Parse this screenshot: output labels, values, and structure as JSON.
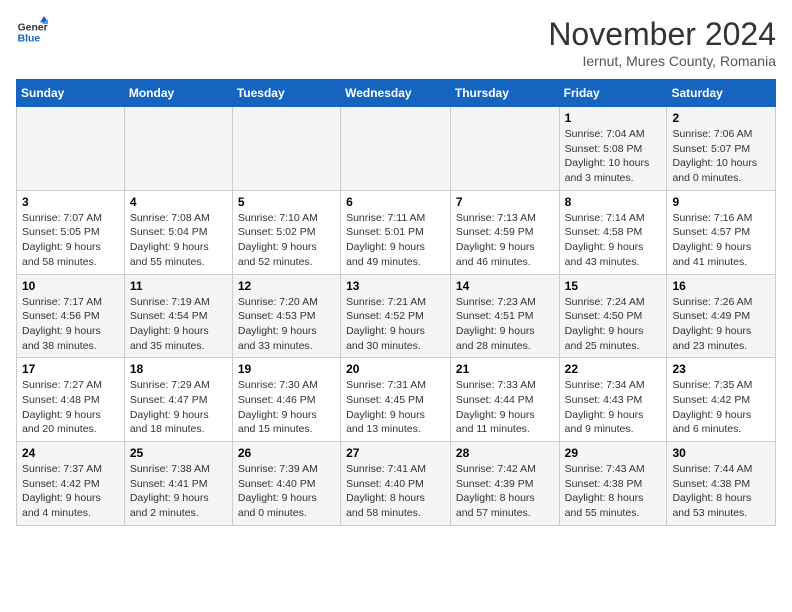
{
  "header": {
    "logo_line1": "General",
    "logo_line2": "Blue",
    "month_title": "November 2024",
    "location": "Iernut, Mures County, Romania"
  },
  "days_of_week": [
    "Sunday",
    "Monday",
    "Tuesday",
    "Wednesday",
    "Thursday",
    "Friday",
    "Saturday"
  ],
  "weeks": [
    [
      {
        "day": "",
        "info": ""
      },
      {
        "day": "",
        "info": ""
      },
      {
        "day": "",
        "info": ""
      },
      {
        "day": "",
        "info": ""
      },
      {
        "day": "",
        "info": ""
      },
      {
        "day": "1",
        "info": "Sunrise: 7:04 AM\nSunset: 5:08 PM\nDaylight: 10 hours\nand 3 minutes."
      },
      {
        "day": "2",
        "info": "Sunrise: 7:06 AM\nSunset: 5:07 PM\nDaylight: 10 hours\nand 0 minutes."
      }
    ],
    [
      {
        "day": "3",
        "info": "Sunrise: 7:07 AM\nSunset: 5:05 PM\nDaylight: 9 hours\nand 58 minutes."
      },
      {
        "day": "4",
        "info": "Sunrise: 7:08 AM\nSunset: 5:04 PM\nDaylight: 9 hours\nand 55 minutes."
      },
      {
        "day": "5",
        "info": "Sunrise: 7:10 AM\nSunset: 5:02 PM\nDaylight: 9 hours\nand 52 minutes."
      },
      {
        "day": "6",
        "info": "Sunrise: 7:11 AM\nSunset: 5:01 PM\nDaylight: 9 hours\nand 49 minutes."
      },
      {
        "day": "7",
        "info": "Sunrise: 7:13 AM\nSunset: 4:59 PM\nDaylight: 9 hours\nand 46 minutes."
      },
      {
        "day": "8",
        "info": "Sunrise: 7:14 AM\nSunset: 4:58 PM\nDaylight: 9 hours\nand 43 minutes."
      },
      {
        "day": "9",
        "info": "Sunrise: 7:16 AM\nSunset: 4:57 PM\nDaylight: 9 hours\nand 41 minutes."
      }
    ],
    [
      {
        "day": "10",
        "info": "Sunrise: 7:17 AM\nSunset: 4:56 PM\nDaylight: 9 hours\nand 38 minutes."
      },
      {
        "day": "11",
        "info": "Sunrise: 7:19 AM\nSunset: 4:54 PM\nDaylight: 9 hours\nand 35 minutes."
      },
      {
        "day": "12",
        "info": "Sunrise: 7:20 AM\nSunset: 4:53 PM\nDaylight: 9 hours\nand 33 minutes."
      },
      {
        "day": "13",
        "info": "Sunrise: 7:21 AM\nSunset: 4:52 PM\nDaylight: 9 hours\nand 30 minutes."
      },
      {
        "day": "14",
        "info": "Sunrise: 7:23 AM\nSunset: 4:51 PM\nDaylight: 9 hours\nand 28 minutes."
      },
      {
        "day": "15",
        "info": "Sunrise: 7:24 AM\nSunset: 4:50 PM\nDaylight: 9 hours\nand 25 minutes."
      },
      {
        "day": "16",
        "info": "Sunrise: 7:26 AM\nSunset: 4:49 PM\nDaylight: 9 hours\nand 23 minutes."
      }
    ],
    [
      {
        "day": "17",
        "info": "Sunrise: 7:27 AM\nSunset: 4:48 PM\nDaylight: 9 hours\nand 20 minutes."
      },
      {
        "day": "18",
        "info": "Sunrise: 7:29 AM\nSunset: 4:47 PM\nDaylight: 9 hours\nand 18 minutes."
      },
      {
        "day": "19",
        "info": "Sunrise: 7:30 AM\nSunset: 4:46 PM\nDaylight: 9 hours\nand 15 minutes."
      },
      {
        "day": "20",
        "info": "Sunrise: 7:31 AM\nSunset: 4:45 PM\nDaylight: 9 hours\nand 13 minutes."
      },
      {
        "day": "21",
        "info": "Sunrise: 7:33 AM\nSunset: 4:44 PM\nDaylight: 9 hours\nand 11 minutes."
      },
      {
        "day": "22",
        "info": "Sunrise: 7:34 AM\nSunset: 4:43 PM\nDaylight: 9 hours\nand 9 minutes."
      },
      {
        "day": "23",
        "info": "Sunrise: 7:35 AM\nSunset: 4:42 PM\nDaylight: 9 hours\nand 6 minutes."
      }
    ],
    [
      {
        "day": "24",
        "info": "Sunrise: 7:37 AM\nSunset: 4:42 PM\nDaylight: 9 hours\nand 4 minutes."
      },
      {
        "day": "25",
        "info": "Sunrise: 7:38 AM\nSunset: 4:41 PM\nDaylight: 9 hours\nand 2 minutes."
      },
      {
        "day": "26",
        "info": "Sunrise: 7:39 AM\nSunset: 4:40 PM\nDaylight: 9 hours\nand 0 minutes."
      },
      {
        "day": "27",
        "info": "Sunrise: 7:41 AM\nSunset: 4:40 PM\nDaylight: 8 hours\nand 58 minutes."
      },
      {
        "day": "28",
        "info": "Sunrise: 7:42 AM\nSunset: 4:39 PM\nDaylight: 8 hours\nand 57 minutes."
      },
      {
        "day": "29",
        "info": "Sunrise: 7:43 AM\nSunset: 4:38 PM\nDaylight: 8 hours\nand 55 minutes."
      },
      {
        "day": "30",
        "info": "Sunrise: 7:44 AM\nSunset: 4:38 PM\nDaylight: 8 hours\nand 53 minutes."
      }
    ]
  ]
}
